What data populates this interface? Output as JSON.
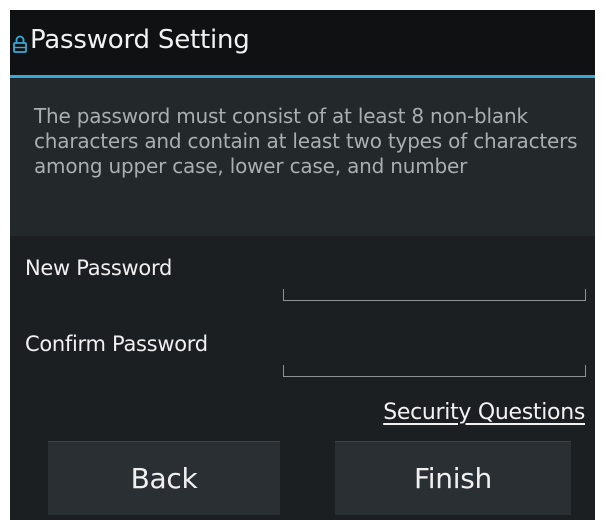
{
  "dialog": {
    "title": "Password Setting",
    "title_icon": "lock-icon",
    "message": "The password must consist of at least 8 non-blank characters and contain at least two types of characters among upper case, lower case, and number",
    "accent_color": "#35a9d8"
  },
  "form": {
    "new_password_label": "New Password",
    "new_password_value": "",
    "confirm_password_label": "Confirm Password",
    "confirm_password_value": "",
    "security_questions_link": "Security Questions"
  },
  "buttons": {
    "back_label": "Back",
    "finish_label": "Finish"
  }
}
